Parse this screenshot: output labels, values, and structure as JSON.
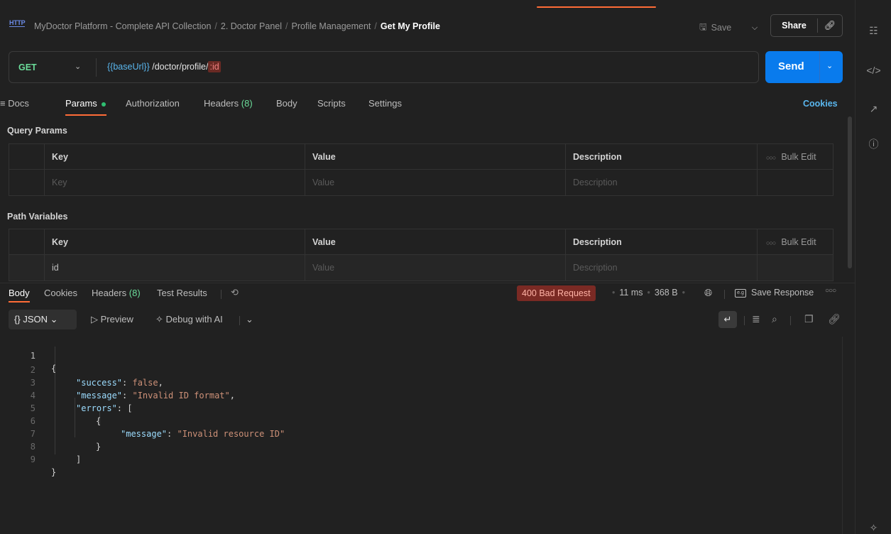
{
  "header": {
    "http_icon_text": "HTTP",
    "breadcrumb": [
      "MyDoctor Platform - Complete API Collection",
      "2. Doctor Panel",
      "Profile Management"
    ],
    "current": "Get My Profile",
    "save_label": "Save",
    "share_label": "Share"
  },
  "request": {
    "method": "GET",
    "url_variable": "{{baseUrl}}",
    "url_path": " /doctor/profile/",
    "url_param": ":id",
    "send_label": "Send"
  },
  "tabs": {
    "docs": "Docs",
    "params": "Params",
    "authorization": "Authorization",
    "headers": "Headers",
    "headers_count": "(8)",
    "body": "Body",
    "scripts": "Scripts",
    "settings": "Settings",
    "cookies": "Cookies"
  },
  "query_params": {
    "title": "Query Params",
    "headers": {
      "key": "Key",
      "value": "Value",
      "description": "Description",
      "bulk_edit": "Bulk Edit"
    },
    "placeholder_row": {
      "key": "Key",
      "value": "Value",
      "description": "Description"
    }
  },
  "path_variables": {
    "title": "Path Variables",
    "headers": {
      "key": "Key",
      "value": "Value",
      "description": "Description",
      "bulk_edit": "Bulk Edit"
    },
    "row": {
      "key": "id",
      "value": "Value",
      "description": "Description"
    }
  },
  "response": {
    "tabs": {
      "body": "Body",
      "cookies": "Cookies",
      "headers": "Headers",
      "headers_count": "(8)",
      "test_results": "Test Results"
    },
    "status": "400 Bad Request",
    "time": "11 ms",
    "size": "368 B",
    "save_response": "Save Response",
    "format": "JSON",
    "preview": "Preview",
    "debug": "Debug with AI",
    "code_lines": [
      {
        "n": "1",
        "text": "{"
      },
      {
        "n": "2",
        "key": "\"success\"",
        "sep": ": ",
        "val": "false",
        "end": ","
      },
      {
        "n": "3",
        "key": "\"message\"",
        "sep": ": ",
        "val": "\"Invalid ID format\"",
        "end": ","
      },
      {
        "n": "4",
        "key": "\"errors\"",
        "sep": ": ",
        "val": "",
        "end": "["
      },
      {
        "n": "5",
        "text": "{"
      },
      {
        "n": "6",
        "key": "\"message\"",
        "sep": ": ",
        "val": "\"Invalid resource ID\"",
        "end": ""
      },
      {
        "n": "7",
        "text": "}"
      },
      {
        "n": "8",
        "text": "]"
      },
      {
        "n": "9",
        "text": "}"
      }
    ]
  },
  "colors": {
    "accent": "#ff6c37",
    "send": "#097bed",
    "method_get": "#6bdd9a",
    "status_error_bg": "#7a2a24"
  }
}
